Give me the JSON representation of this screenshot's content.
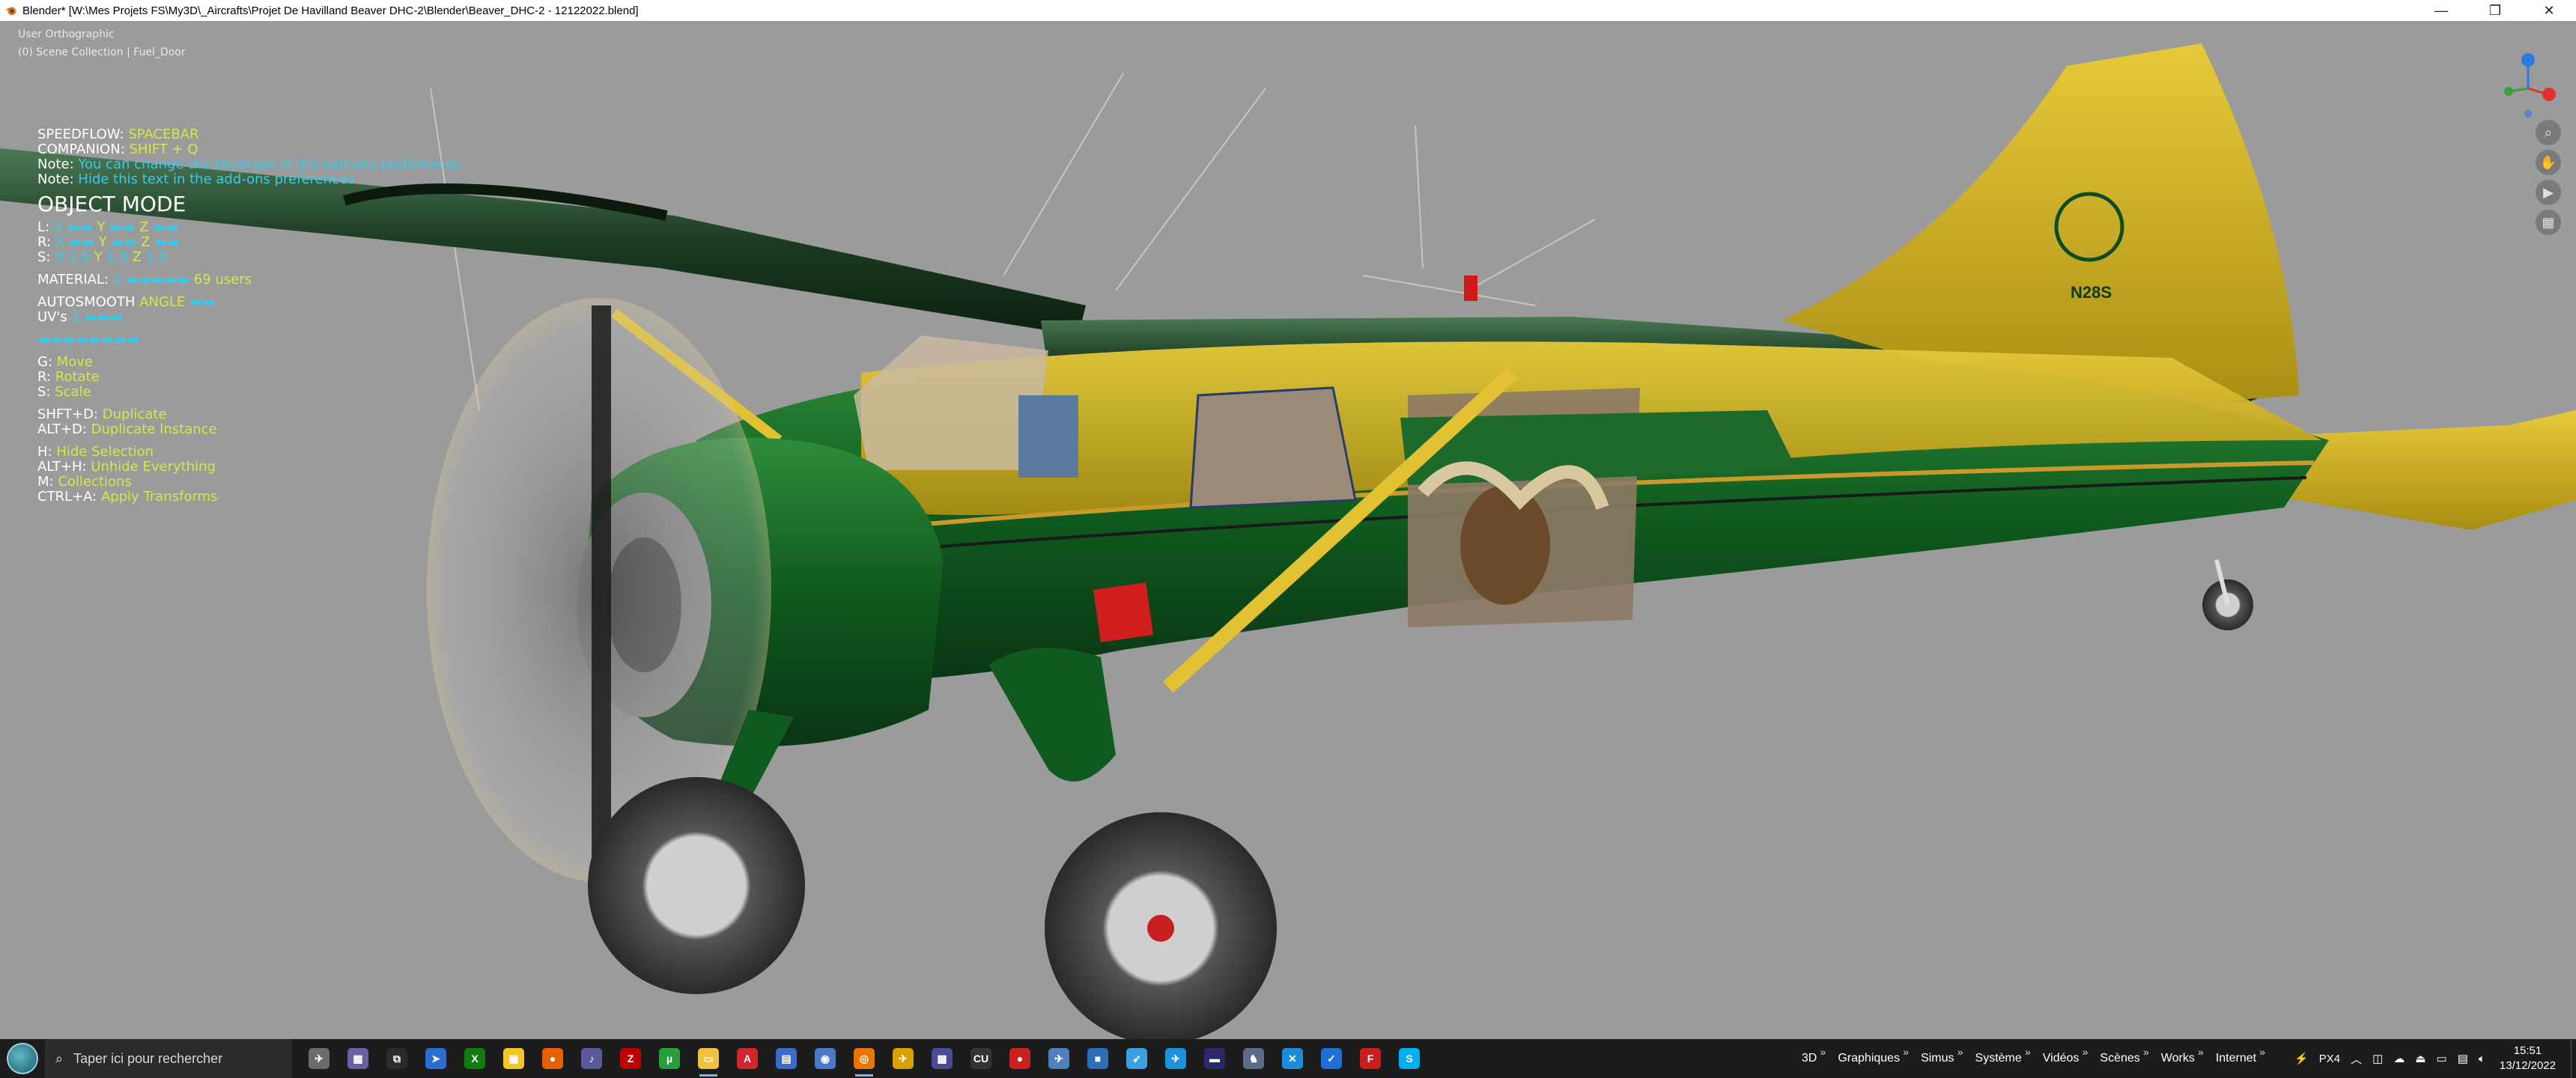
{
  "window": {
    "title": "Blender* [W:\\Mes Projets FS\\My3D\\_Aircrafts\\Projet De Havilland Beaver DHC-2\\Blender\\Beaver_DHC-2 - 12122022.blend]",
    "minimize_icon": "minimize-icon",
    "restore_icon": "restore-icon",
    "close_icon": "close-icon"
  },
  "viewport": {
    "view_name": "User Orthographic",
    "collection_info": "(0) Scene Collection | Fuel_Door",
    "aircraft_registration": "N28S"
  },
  "overlay": {
    "speedflow_label": "SPEEDFLOW:",
    "speedflow_key": "SPACEBAR",
    "companion_label": "COMPANION:",
    "companion_key": "SHIFT + Q",
    "note1_label": "Note:",
    "note1_text": "You can change the keymaps in the add-ons preferences",
    "note2_label": "Note:",
    "note2_text": "Hide this text in the add-ons preferences",
    "mode": "OBJECT MODE",
    "loc_label": "L:",
    "rot_label": "R:",
    "scale_label": "S:",
    "axis_x": "X",
    "axis_y": "Y",
    "axis_z": "Z",
    "scale_x": "1.0",
    "scale_y": "1.0",
    "scale_z": "1.0",
    "material_label": "MATERIAL:",
    "material_count": "1",
    "material_users": "69 users",
    "autosmooth_label": "AUTOSMOOTH",
    "autosmooth_angle_label": "ANGLE",
    "uvs_label": "UV's",
    "uvs_count": "1",
    "g_key": "G:",
    "g_action": "Move",
    "r_key": "R:",
    "r_action": "Rotate",
    "s_key": "S:",
    "s_action": "Scale",
    "shftd_key": "SHFT+D:",
    "shftd_action": "Duplicate",
    "altd_key": "ALT+D:",
    "altd_action": "Duplicate Instance",
    "h_key": "H:",
    "h_action": "Hide Selection",
    "alth_key": "ALT+H:",
    "alth_action": "Unhide Everything",
    "m_key": "M:",
    "m_action": "Collections",
    "ctrla_key": "CTRL+A:",
    "ctrla_action": "Apply Transforms"
  },
  "nav_buttons": [
    "zoom-icon",
    "hand-pan-icon",
    "camera-icon",
    "grid-icon"
  ],
  "taskbar": {
    "search_placeholder": "Taper ici pour rechercher",
    "apps": [
      {
        "icon": "blender-helper-icon",
        "color": "#6b6b6b",
        "glyph": "✈"
      },
      {
        "icon": "multitask-icon",
        "color": "#6a5fa0",
        "glyph": "▦"
      },
      {
        "icon": "task-view-icon",
        "color": "#2b2b2b",
        "glyph": "⧉"
      },
      {
        "icon": "paper-plane-icon",
        "color": "#2a6fd0",
        "glyph": "➤"
      },
      {
        "icon": "xbox-icon",
        "color": "#107c10",
        "glyph": "X"
      },
      {
        "icon": "store-icon",
        "color": "#f3c623",
        "glyph": "▣"
      },
      {
        "icon": "firefox-icon",
        "color": "#e66000",
        "glyph": "●"
      },
      {
        "icon": "music-icon",
        "color": "#5a5a9a",
        "glyph": "♪"
      },
      {
        "icon": "filezilla-icon",
        "color": "#bf0000",
        "glyph": "Z"
      },
      {
        "icon": "utorrent-icon",
        "color": "#2a9d3c",
        "glyph": "µ"
      },
      {
        "icon": "file-explorer-icon",
        "color": "#f0c040",
        "glyph": "▭"
      },
      {
        "icon": "acrobat-icon",
        "color": "#d0262f",
        "glyph": "A"
      },
      {
        "icon": "app-book-icon",
        "color": "#3c6ac8",
        "glyph": "▤"
      },
      {
        "icon": "globe-icon",
        "color": "#4a79c8",
        "glyph": "◉"
      },
      {
        "icon": "blender-icon",
        "color": "#ea7600",
        "glyph": "◎"
      },
      {
        "icon": "plane-icon",
        "color": "#d8a000",
        "glyph": "✈"
      },
      {
        "icon": "monitor-icon",
        "color": "#4a4a9a",
        "glyph": "▩"
      },
      {
        "icon": "cu-icon",
        "color": "#333333",
        "glyph": "CU"
      },
      {
        "icon": "record-icon",
        "color": "#cc1f1f",
        "glyph": "●"
      },
      {
        "icon": "jet-icon",
        "color": "#5080c0",
        "glyph": "✈"
      },
      {
        "icon": "square-app-icon",
        "color": "#2a6fb8",
        "glyph": "■"
      },
      {
        "icon": "bird-icon",
        "color": "#3aa0e0",
        "glyph": "➶"
      },
      {
        "icon": "plane-blue-icon",
        "color": "#1e90e0",
        "glyph": "✈"
      },
      {
        "icon": "nav-app-icon",
        "color": "#2a2a6a",
        "glyph": "▬"
      },
      {
        "icon": "eagle-icon",
        "color": "#5a6a8a",
        "glyph": "♞"
      },
      {
        "icon": "x-app-icon",
        "color": "#1a8cd8",
        "glyph": "✕"
      },
      {
        "icon": "check-app-icon",
        "color": "#1e6fd8",
        "glyph": "✓"
      },
      {
        "icon": "flight-app-icon",
        "color": "#c81e1e",
        "glyph": "F"
      },
      {
        "icon": "skype-icon",
        "color": "#00aff0",
        "glyph": "S"
      }
    ],
    "toolbars": [
      "3D",
      "Graphiques",
      "Simus",
      "Système",
      "Vidéos",
      "Scènes",
      "Works",
      "Internet"
    ],
    "tray": {
      "app": "PX4",
      "time": "15:51",
      "date": "13/12/2022"
    }
  }
}
